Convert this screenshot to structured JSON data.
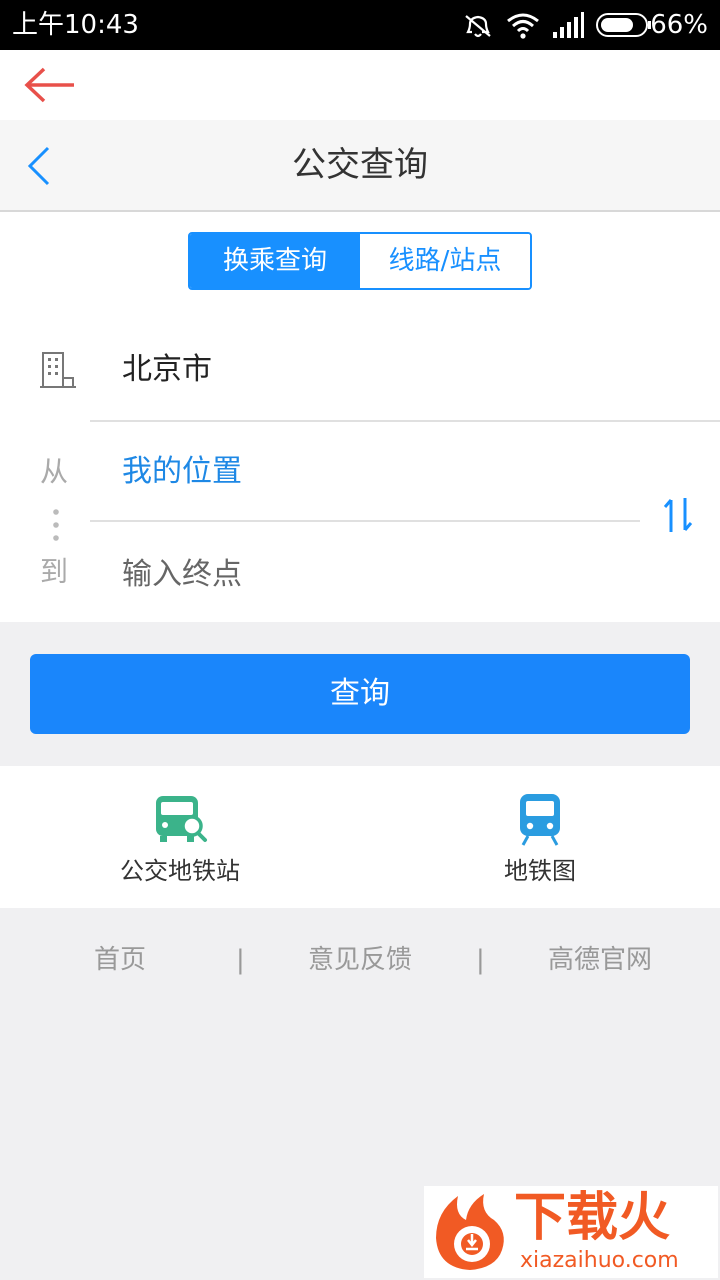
{
  "status_bar": {
    "time": "上午10:43",
    "battery_percent": "66%",
    "icons": [
      "mute-icon",
      "wifi-icon",
      "signal-icon",
      "battery-icon"
    ]
  },
  "app_bar": {
    "back_icon": "arrow-left-icon"
  },
  "header": {
    "title": "公交查询",
    "back_icon": "chevron-left-icon"
  },
  "mode_tabs": [
    {
      "label": "换乘查询",
      "selected": true
    },
    {
      "label": "线路/站点",
      "selected": false
    }
  ],
  "route_form": {
    "city": "北京市",
    "from_label": "从",
    "from_value": "我的位置",
    "to_label": "到",
    "to_placeholder": "输入终点",
    "swap_icon": "swap-vertical-icon"
  },
  "query_button_label": "查询",
  "quick_links": [
    {
      "label": "公交地铁站",
      "icon": "bus-search-icon",
      "color": "#3bb38a"
    },
    {
      "label": "地铁图",
      "icon": "subway-icon",
      "color": "#2a9ce0"
    }
  ],
  "footer": {
    "links": [
      "首页",
      "意见反馈",
      "高德官网"
    ],
    "separator": "|"
  },
  "watermark": {
    "brand": "下载火",
    "domain": "xiazaihuo.com"
  },
  "colors": {
    "accent": "#1890ff",
    "button": "#1a86fb",
    "watermark": "#f15a24"
  }
}
